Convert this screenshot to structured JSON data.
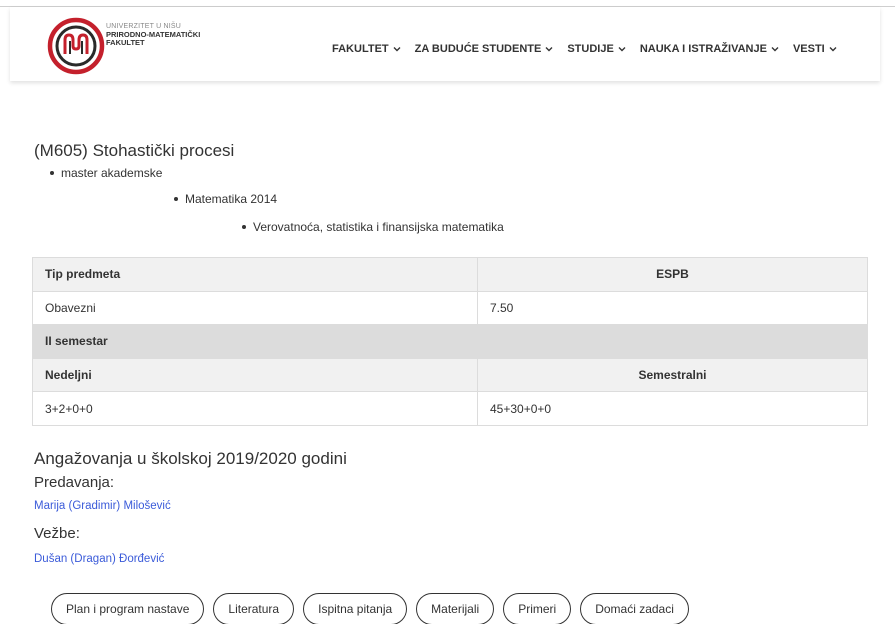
{
  "header": {
    "logo_line1": "UNIVERZITET U NIŠU",
    "logo_line2": "PRIRODNO-MATEMATIČKI",
    "logo_line3": "FAKULTET",
    "colors": {
      "logo_red": "#c4202c"
    }
  },
  "nav": {
    "items": [
      {
        "label": "FAKULTET"
      },
      {
        "label": "ZA BUDUĆE STUDENTE"
      },
      {
        "label": "STUDIJE"
      },
      {
        "label": "NAUKA I ISTRAŽIVANJE"
      },
      {
        "label": "VESTI"
      }
    ]
  },
  "course": {
    "title": "(M605) Stohastički procesi",
    "level": "master akademske",
    "program": "Matematika 2014",
    "module": "Verovatnoća, statistika i finansijska matematika"
  },
  "table": {
    "tip_predmeta_header": "Tip predmeta",
    "espb_header": "ESPB",
    "tip_predmeta": "Obavezni",
    "espb": "7.50",
    "semester": "II semestar",
    "nedeljni_header": "Nedeljni",
    "semestralni_header": "Semestralni",
    "nedeljni": "3+2+0+0",
    "semestralni": "45+30+0+0"
  },
  "engagement": {
    "title": "Angažovanja u školskoj 2019/2020 godini",
    "lectures_label": "Predavanja:",
    "lecturer": "Marija (Gradimir) Milošević",
    "exercises_label": "Vežbe:",
    "assistant": "Dušan (Dragan) Đorđević"
  },
  "buttons": [
    {
      "label": "Plan i program nastave"
    },
    {
      "label": "Literatura"
    },
    {
      "label": "Ispitna pitanja"
    },
    {
      "label": "Materijali"
    },
    {
      "label": "Primeri"
    },
    {
      "label": "Domaći zadaci"
    }
  ]
}
